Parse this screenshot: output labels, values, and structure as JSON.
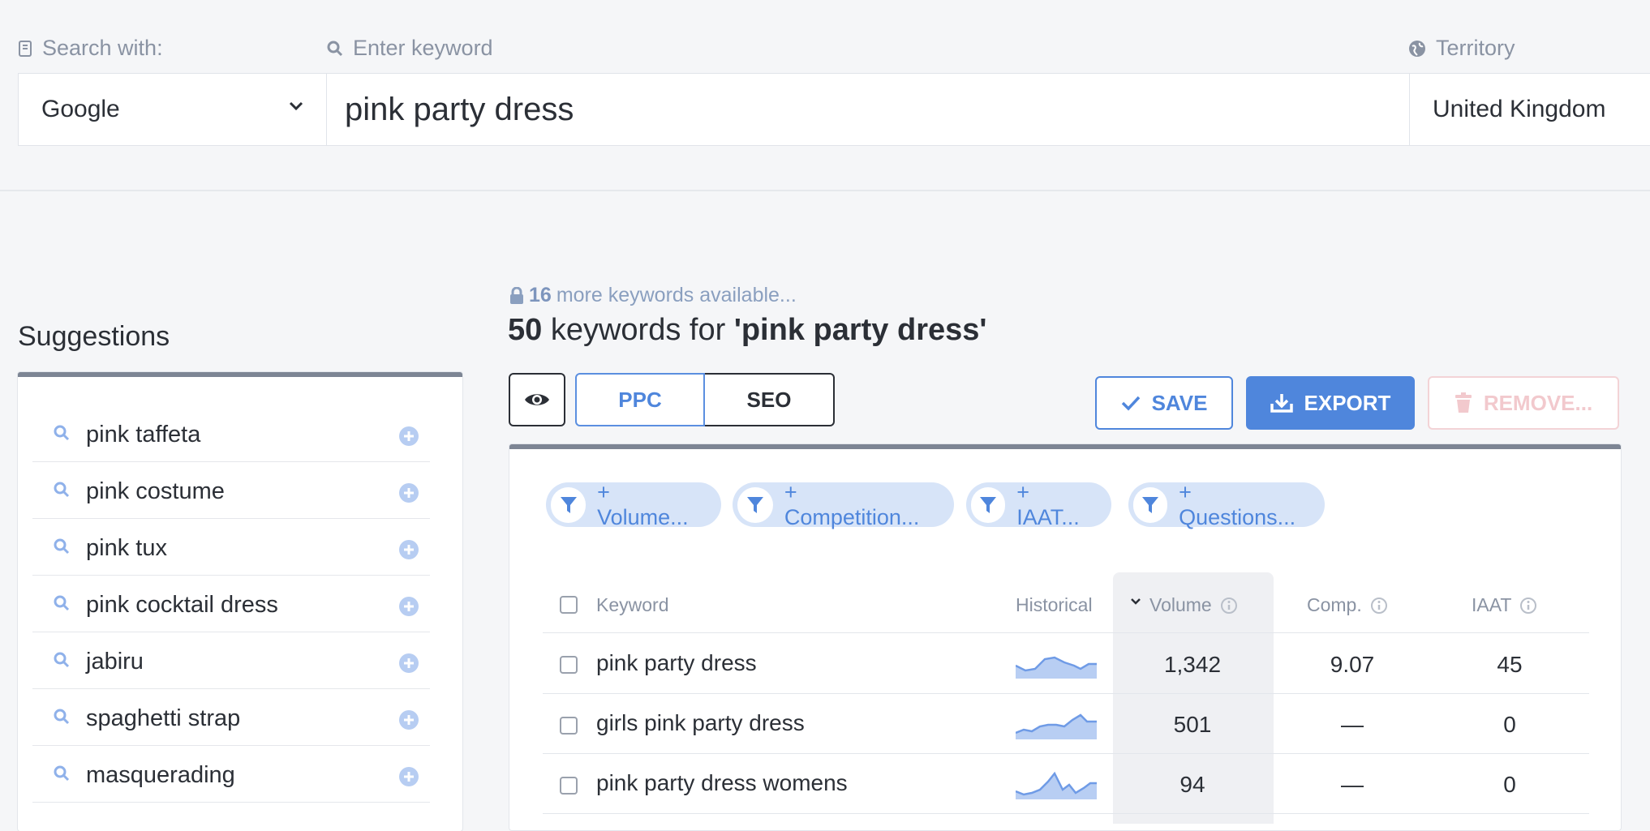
{
  "search": {
    "search_with_label": "Search with:",
    "keyword_label": "Enter keyword",
    "territory_label": "Territory",
    "engine_value": "Google",
    "keyword_value": "pink party dress",
    "territory_value": "United Kingdom"
  },
  "suggestions": {
    "title": "Suggestions",
    "items": [
      {
        "label": "pink taffeta"
      },
      {
        "label": "pink costume"
      },
      {
        "label": "pink tux"
      },
      {
        "label": "pink cocktail dress"
      },
      {
        "label": "jabiru"
      },
      {
        "label": "spaghetti strap"
      },
      {
        "label": "masquerading"
      }
    ]
  },
  "results": {
    "more_count": "16",
    "more_text": "more keywords available...",
    "count": "50",
    "title_middle": "keywords for",
    "title_keyword": "'pink party dress'",
    "tabs": {
      "ppc": "PPC",
      "seo": "SEO"
    },
    "buttons": {
      "save": "SAVE",
      "export": "EXPORT",
      "remove": "REMOVE..."
    },
    "filters": [
      "+ Volume...",
      "+ Competition...",
      "+ IAAT...",
      "+ Questions..."
    ],
    "columns": {
      "keyword": "Keyword",
      "historical": "Historical",
      "volume": "Volume",
      "comp": "Comp.",
      "iaat": "IAAT"
    },
    "rows": [
      {
        "keyword": "pink party dress",
        "volume": "1,342",
        "comp": "9.07",
        "iaat": "45"
      },
      {
        "keyword": "girls pink party dress",
        "volume": "501",
        "comp": "—",
        "iaat": "0"
      },
      {
        "keyword": "pink party dress womens",
        "volume": "94",
        "comp": "—",
        "iaat": "0"
      }
    ]
  },
  "colors": {
    "accent": "#4f86dc",
    "chip_bg": "#d7e4f8",
    "remove_disabled": "#f2c9cd"
  }
}
